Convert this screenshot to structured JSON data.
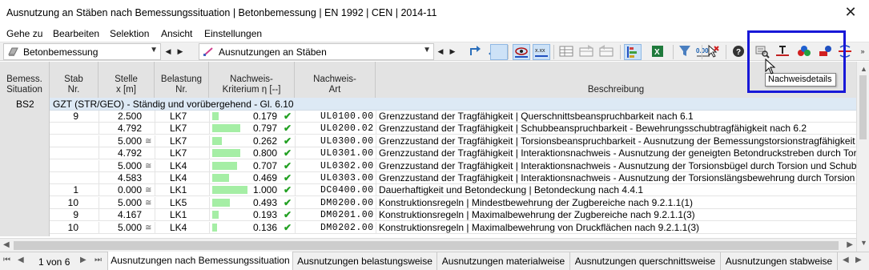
{
  "window": {
    "title": "Ausnutzung an Stäben nach Bemessungssituation | Betonbemessung | EN 1992 | CEN | 2014-11",
    "close_glyph": "✕"
  },
  "menu": [
    "Gehe zu",
    "Bearbeiten",
    "Selektion",
    "Ansicht",
    "Einstellungen"
  ],
  "toolbar": {
    "module_combo": "Betonbemessung",
    "view_combo": "Ausnutzungen an Stäben",
    "tooltip": "Nachweisdetails",
    "icons": [
      "goto-icon",
      "goto-back-icon",
      "visibility-icon",
      "xxx-icon",
      "table-icon",
      "table-export-icon",
      "table-import-icon",
      "filter-settings-icon",
      "excel-icon",
      "filter-icon",
      "decimal-places-icon",
      "select-icon",
      "help-icon",
      "design-details-icon",
      "section-icon",
      "results-icon",
      "members-icon",
      "moments-icon"
    ],
    "pressed": [
      "visibility-icon",
      "xxx-icon",
      "filter-settings-icon"
    ]
  },
  "table": {
    "headers": [
      [
        "Bemess.",
        "Situation"
      ],
      [
        "Stab",
        "Nr."
      ],
      [
        "Stelle",
        "x [m]"
      ],
      [
        "Belastung",
        "Nr."
      ],
      [
        "Nachweis-",
        "Kriterium η [--]"
      ],
      [
        "Nachweis-",
        "Art"
      ],
      [
        "",
        "Beschreibung"
      ]
    ],
    "situation": "BS2",
    "group_label": "GZT (STR/GEO) - Ständig und vorübergehend - Gl. 6.10",
    "rows": [
      {
        "stab": "9",
        "stelle": "2.500",
        "eq": "",
        "lk": "LK7",
        "ratio": 0.179,
        "ratio_text": "0.179",
        "art": "UL0100.00",
        "desc": "Grenzzustand der Tragfähigkeit | Querschnittsbeanspruchbarkeit nach 6.1"
      },
      {
        "stab": "",
        "stelle": "4.792",
        "eq": "",
        "lk": "LK7",
        "ratio": 0.797,
        "ratio_text": "0.797",
        "art": "UL0200.02",
        "desc": "Grenzzustand der Tragfähigkeit | Schubbeanspruchbarkeit - Bewehrungsschubtragfähigkeit nach 6.2"
      },
      {
        "stab": "",
        "stelle": "5.000",
        "eq": "≅",
        "lk": "LK7",
        "ratio": 0.262,
        "ratio_text": "0.262",
        "art": "UL0300.00",
        "desc": "Grenzzustand der Tragfähigkeit | Torsionsbeanspruchbarkeit - Ausnutzung der Bemessungstorsionstragfähigkeit nu"
      },
      {
        "stab": "",
        "stelle": "4.792",
        "eq": "",
        "lk": "LK7",
        "ratio": 0.8,
        "ratio_text": "0.800",
        "art": "UL0301.00",
        "desc": "Grenzzustand der Tragfähigkeit | Interaktionsnachweis - Ausnutzung der geneigten Betondruckstreben durch Torsio"
      },
      {
        "stab": "",
        "stelle": "5.000",
        "eq": "≅",
        "lk": "LK4",
        "ratio": 0.707,
        "ratio_text": "0.707",
        "art": "UL0302.00",
        "desc": "Grenzzustand der Tragfähigkeit | Interaktionsnachweis - Ausnutzung der Torsionsbügel durch Torsion und Schub n"
      },
      {
        "stab": "",
        "stelle": "4.583",
        "eq": "",
        "lk": "LK4",
        "ratio": 0.469,
        "ratio_text": "0.469",
        "art": "UL0303.00",
        "desc": "Grenzzustand der Tragfähigkeit | Interaktionsnachweis - Ausnutzung der Torsionslängsbewehrung durch Torsion u"
      },
      {
        "stab": "1",
        "stelle": "0.000",
        "eq": "≅",
        "lk": "LK1",
        "ratio": 1.0,
        "ratio_text": "1.000",
        "art": "DC0400.00",
        "desc": "Dauerhaftigkeit und Betondeckung | Betondeckung nach 4.4.1"
      },
      {
        "stab": "10",
        "stelle": "5.000",
        "eq": "≅",
        "lk": "LK5",
        "ratio": 0.493,
        "ratio_text": "0.493",
        "art": "DM0200.00",
        "desc": "Konstruktionsregeln | Mindestbewehrung der Zugbereiche nach 9.2.1.1(1)"
      },
      {
        "stab": "9",
        "stelle": "4.167",
        "eq": "",
        "lk": "LK1",
        "ratio": 0.193,
        "ratio_text": "0.193",
        "art": "DM0201.00",
        "desc": "Konstruktionsregeln | Maximalbewehrung der Zugbereiche nach 9.2.1.1(3)"
      },
      {
        "stab": "10",
        "stelle": "5.000",
        "eq": "≅",
        "lk": "LK4",
        "ratio": 0.136,
        "ratio_text": "0.136",
        "art": "DM0202.00",
        "desc": "Konstruktionsregeln | Maximalbewehrung von Druckflächen nach 9.2.1.1(3)"
      }
    ],
    "check_glyph": "✔"
  },
  "footer": {
    "page_info": "1 von 6",
    "tabs": [
      "Ausnutzungen nach Bemessungssituation",
      "Ausnutzungen belastungsweise",
      "Ausnutzungen materialweise",
      "Ausnutzungen querschnittsweise",
      "Ausnutzungen stabweise"
    ],
    "active_tab": 0
  },
  "colors": {
    "bar_fill": "#a5eea5",
    "group_row": "#dde9f5",
    "highlight_box": "#1818d8",
    "check": "#22a022"
  }
}
